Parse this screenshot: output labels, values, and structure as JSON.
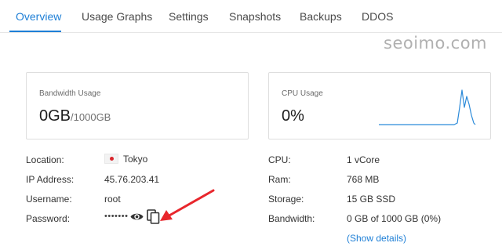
{
  "tabs": [
    {
      "label": "Overview",
      "active": true
    },
    {
      "label": "Usage Graphs",
      "active": false
    },
    {
      "label": "Settings",
      "active": false
    },
    {
      "label": "Snapshots",
      "active": false
    },
    {
      "label": "Backups",
      "active": false
    },
    {
      "label": "DDOS",
      "active": false
    }
  ],
  "watermark": "seoimo.com",
  "bandwidth_card": {
    "title": "Bandwidth Usage",
    "used": "0GB",
    "total": "/1000GB"
  },
  "cpu_card": {
    "title": "CPU Usage",
    "value": "0%"
  },
  "info_left": {
    "location": {
      "label": "Location:",
      "value": "Tokyo"
    },
    "ip": {
      "label": "IP Address:",
      "value": "45.76.203.41"
    },
    "username": {
      "label": "Username:",
      "value": "root"
    },
    "password": {
      "label": "Password:",
      "value": "•••••••"
    }
  },
  "info_right": {
    "cpu": {
      "label": "CPU:",
      "value": "1 vCore"
    },
    "ram": {
      "label": "Ram:",
      "value": "768 MB"
    },
    "storage": {
      "label": "Storage:",
      "value": "15 GB SSD"
    },
    "bandwidth": {
      "label": "Bandwidth:",
      "value": "0 GB of 1000 GB (0%)"
    },
    "details_link": "(Show details)"
  },
  "icons": {
    "flag": "japan-flag-icon",
    "eye": "eye-icon",
    "copy": "copy-icon",
    "arrow": "red-arrow-annotation"
  },
  "colors": {
    "accent": "#1e7fd6",
    "arrow": "#e8262c",
    "sparkline": "#2b8ad9"
  }
}
